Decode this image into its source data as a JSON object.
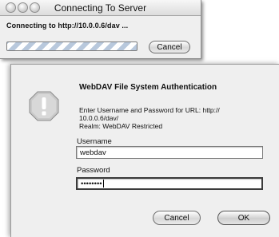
{
  "connect_window": {
    "title": "Connecting To Server",
    "message": "Connecting to http://10.0.0.6/dav ...",
    "cancel_label": "Cancel"
  },
  "auth_dialog": {
    "title": "WebDAV File System Authentication",
    "prompt_lines": [
      "Enter Username and Password for URL: http://",
      "10.0.0.6/dav/",
      "Realm: WebDAV Restricted"
    ],
    "username_label": "Username",
    "username_value": "webdav",
    "password_label": "Password",
    "password_masked": "••••••••",
    "cancel_label": "Cancel",
    "ok_label": "OK",
    "icon": "alert-exclamation-icon"
  }
}
